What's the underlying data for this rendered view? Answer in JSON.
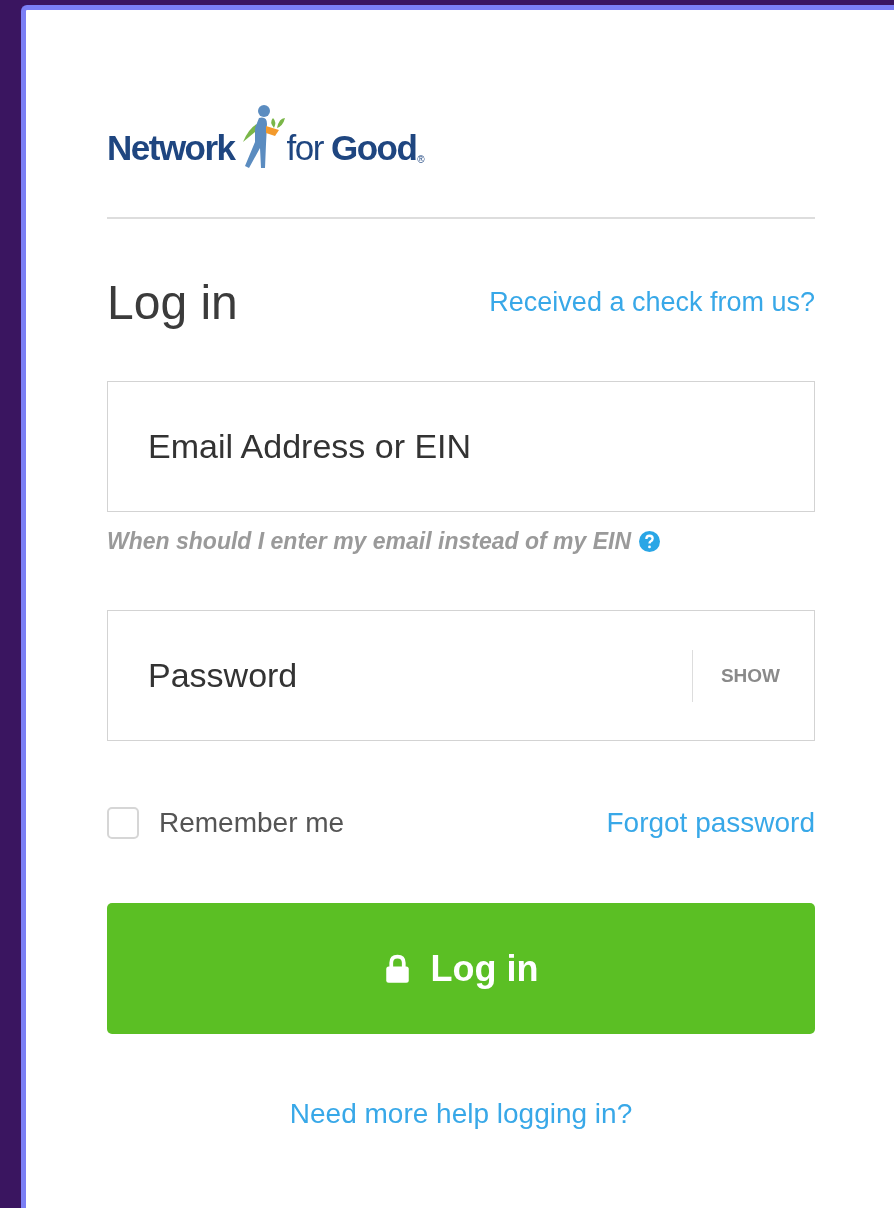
{
  "logo": {
    "word_1": "Network",
    "word_2": "for",
    "word_3": "Good",
    "mark": "®"
  },
  "heading": "Log in",
  "check_link": "Received a check from us?",
  "email_field": {
    "placeholder": "Email Address or EIN"
  },
  "email_hint": "When should I enter my email instead of my EIN",
  "password_field": {
    "placeholder": "Password",
    "toggle": "SHOW"
  },
  "remember": {
    "label": "Remember me",
    "checked": false
  },
  "forgot_link": "Forgot password",
  "login_button": "Log in",
  "help_link": "Need more help logging in?"
}
